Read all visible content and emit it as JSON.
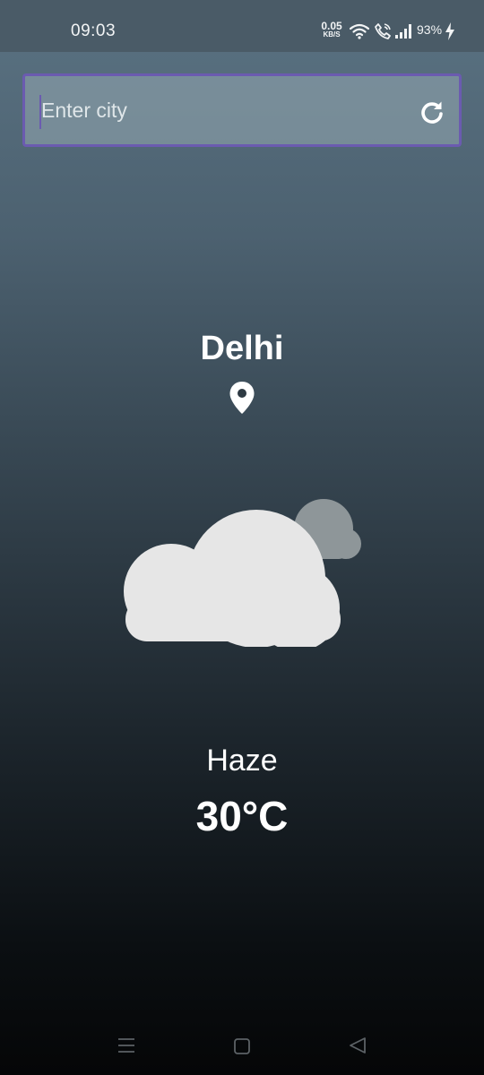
{
  "status_bar": {
    "time": "09:03",
    "net_speed_value": "0.05",
    "net_speed_unit": "KB/S",
    "battery": "93%",
    "icons": [
      "wifi-icon",
      "call-icon",
      "signal-icon",
      "charging-icon"
    ]
  },
  "search": {
    "placeholder": "Enter city",
    "value": "",
    "border_color": "#6b5bb0",
    "refresh_icon": "refresh-icon"
  },
  "location": {
    "city": "Delhi",
    "icon": "location-pin-icon"
  },
  "weather": {
    "icon": "cloudy-icon",
    "condition": "Haze",
    "temperature": "30°C"
  },
  "nav_bar": {
    "icons": [
      "menu-icon",
      "home-icon",
      "back-icon"
    ]
  }
}
